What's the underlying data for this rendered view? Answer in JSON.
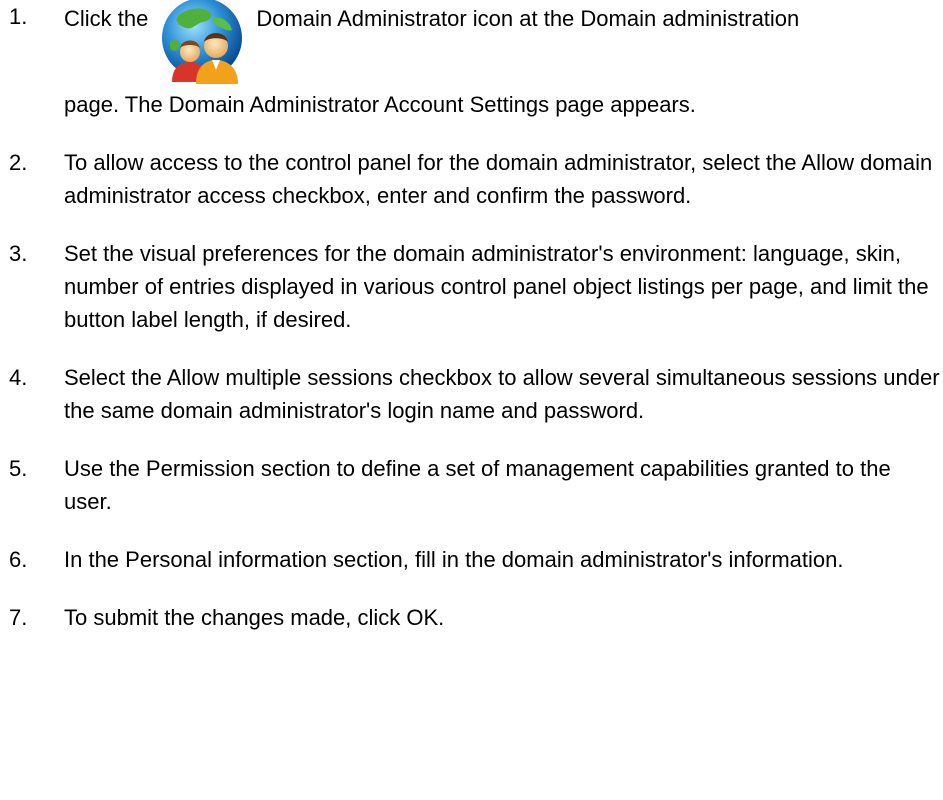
{
  "steps": [
    {
      "number": "1.",
      "pre": "Click the",
      "icon": "domain-administrator-icon",
      "post": "Domain Administrator icon at the Domain administration",
      "cont": "page. The Domain Administrator Account Settings page appears."
    },
    {
      "number": "2.",
      "text": "To allow access to the control panel for the domain administrator, select the Allow domain administrator access checkbox, enter and confirm the password."
    },
    {
      "number": "3.",
      "text": "Set the visual preferences for the domain administrator's environment: language, skin, number of entries displayed in various control panel object listings per page, and limit the button label length, if desired."
    },
    {
      "number": "4.",
      "text": "Select the Allow multiple sessions checkbox to allow several simultaneous sessions under the same domain administrator's login name and password."
    },
    {
      "number": "5.",
      "text": "Use the Permission section to define a set of management capabilities granted to the user."
    },
    {
      "number": "6.",
      "text": "In the Personal information section, fill in the domain administrator's information."
    },
    {
      "number": "7.",
      "text": "To submit the changes made, click OK."
    }
  ],
  "colors": {
    "text": "#000000",
    "background": "#ffffff"
  }
}
